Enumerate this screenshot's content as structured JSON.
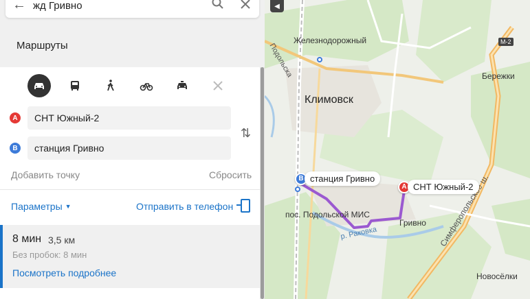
{
  "search": {
    "query": "жд Гривно"
  },
  "panel": {
    "title": "Маршруты",
    "point_a": {
      "letter": "A",
      "value": "СНТ Южный-2",
      "color": "#e53935"
    },
    "point_b": {
      "letter": "B",
      "value": "станция Гривно",
      "color": "#3d7bd9"
    },
    "add_point": "Добавить точку",
    "reset": "Сбросить",
    "params": "Параметры",
    "send": "Отправить в телефон",
    "result": {
      "time": "8 мин",
      "distance": "3,5 км",
      "no_traffic": "Без пробок: 8 мин",
      "details": "Посмотреть подробнее"
    }
  },
  "modes": [
    {
      "name": "car",
      "active": true
    },
    {
      "name": "bus",
      "active": false
    },
    {
      "name": "walk",
      "active": false
    },
    {
      "name": "bike",
      "active": false
    },
    {
      "name": "taxi",
      "active": false
    },
    {
      "name": "scooter",
      "active": false
    }
  ],
  "map": {
    "labels": {
      "zheleznodorozhny": "Железнодорожный",
      "klimovsk": "Климовск",
      "berezhki": "Бережки",
      "podolsk_mis": "пос. Подольской МИС",
      "grivno": "Гривно",
      "novosyolki": "Новосёлки",
      "road_podolska": "Подольска",
      "river": "р. Раковка",
      "highway": "Симферопольское ш.",
      "m2": "М-2"
    },
    "marker_a": "СНТ Южный-2",
    "marker_b": "станция Гривно",
    "colors": {
      "route": "#9b59d0",
      "forest": "#d5e8c6",
      "road": "#f2c77a"
    }
  }
}
